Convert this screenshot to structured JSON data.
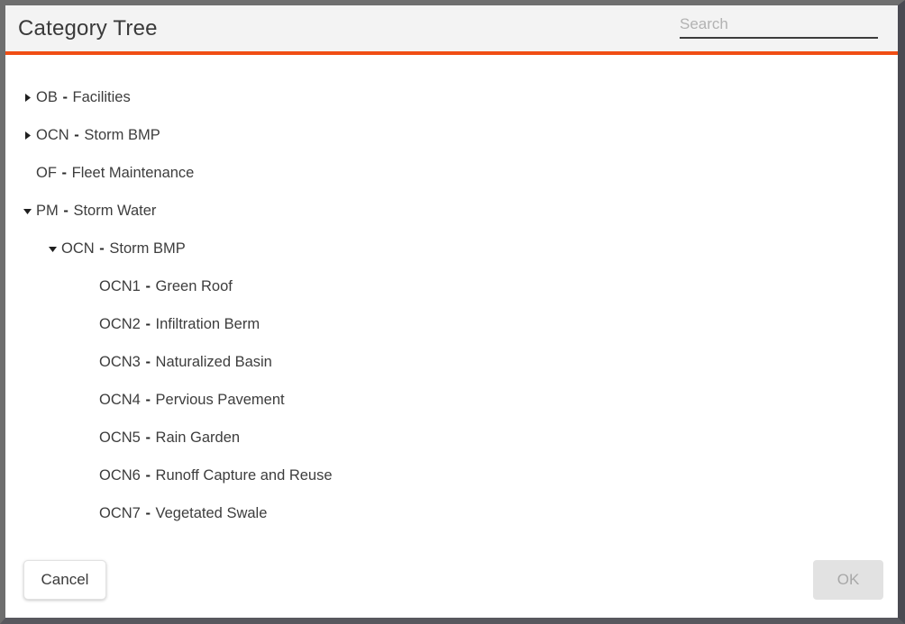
{
  "header": {
    "title": "Category Tree",
    "search": {
      "placeholder": "Search",
      "value": ""
    }
  },
  "colors": {
    "accent_bar": "#f04e14",
    "header_background": "#f3f3f3",
    "window_border": "#6e6e6e",
    "text": "#3d3d3d",
    "disabled_button_background": "#e2e2e2",
    "disabled_button_text": "#a8a8a8"
  },
  "tree": {
    "items": [
      {
        "code": "OB",
        "name": "Facilities",
        "depth": 0,
        "state": "collapsed"
      },
      {
        "code": "OCN",
        "name": "Storm BMP",
        "depth": 0,
        "state": "collapsed"
      },
      {
        "code": "OF",
        "name": "Fleet Maintenance",
        "depth": 0,
        "state": "leaf"
      },
      {
        "code": "PM",
        "name": "Storm Water",
        "depth": 0,
        "state": "expanded"
      },
      {
        "code": "OCN",
        "name": "Storm BMP",
        "depth": 1,
        "state": "expanded"
      },
      {
        "code": "OCN1",
        "name": "Green Roof",
        "depth": 2,
        "state": "leaf"
      },
      {
        "code": "OCN2",
        "name": "Infiltration Berm",
        "depth": 2,
        "state": "leaf"
      },
      {
        "code": "OCN3",
        "name": "Naturalized Basin",
        "depth": 2,
        "state": "leaf"
      },
      {
        "code": "OCN4",
        "name": "Pervious Pavement",
        "depth": 2,
        "state": "leaf"
      },
      {
        "code": "OCN5",
        "name": "Rain Garden",
        "depth": 2,
        "state": "leaf"
      },
      {
        "code": "OCN6",
        "name": "Runoff Capture and Reuse",
        "depth": 2,
        "state": "leaf"
      },
      {
        "code": "OCN7",
        "name": "Vegetated Swale",
        "depth": 2,
        "state": "leaf"
      }
    ],
    "separator": "-"
  },
  "footer": {
    "cancel_label": "Cancel",
    "ok_label": "OK",
    "ok_enabled": false
  }
}
